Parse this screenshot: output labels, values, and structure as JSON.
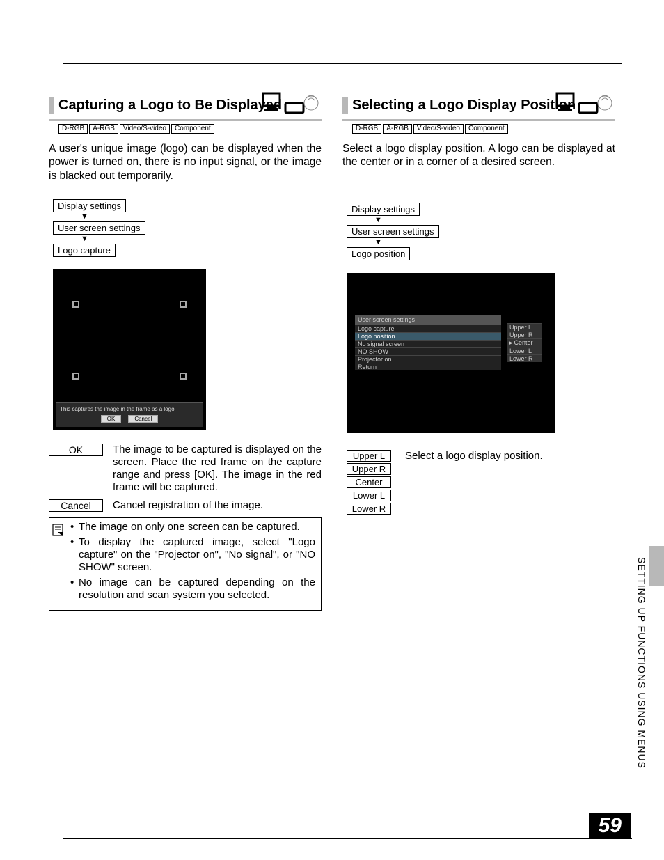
{
  "page_number": "59",
  "side_label": "SETTING UP FUNCTIONS USING MENUS",
  "input_tags": [
    "D-RGB",
    "A-RGB",
    "Video/S-video",
    "Component"
  ],
  "left": {
    "title": "Capturing a Logo to Be Displayed",
    "intro": "A user's unique image (logo) can be displayed when the power is turned on, there is no input signal, or the image is blacked out temporarily.",
    "menu_path": [
      "Display settings",
      "User screen settings",
      "Logo capture"
    ],
    "capture_panel_text": "This captures the image in the frame as a logo.",
    "capture_buttons": {
      "ok": "OK",
      "cancel": "Cancel"
    },
    "defs": {
      "ok_label": "OK",
      "ok_desc": "The image to be captured is displayed on the screen. Place the red frame on the capture range and press [OK]. The image in the red frame will be captured.",
      "cancel_label": "Cancel",
      "cancel_desc": "Cancel registration of the image."
    },
    "notes": [
      "The image on only one screen can be captured.",
      "To display the captured image, select \"Logo capture\" on the \"Projector on\", \"No signal\", or \"NO SHOW\" screen.",
      "No image can be captured depending on the resolution and scan system you selected."
    ]
  },
  "right": {
    "title": "Selecting a Logo Display Position",
    "intro": "Select a logo display position. A logo can be displayed at the center or in a corner of a desired screen.",
    "menu_path": [
      "Display settings",
      "User screen settings",
      "Logo position"
    ],
    "settings_panel": {
      "title": "User screen settings",
      "rows": [
        {
          "l": "Logo capture",
          "r": ""
        },
        {
          "l": "Logo position",
          "r": ""
        },
        {
          "l": "No signal screen",
          "r": ""
        },
        {
          "l": "NO SHOW",
          "r": ""
        },
        {
          "l": "Projector on",
          "r": ""
        },
        {
          "l": "Return",
          "r": ""
        }
      ],
      "popup": [
        "Upper L",
        "Upper R",
        "Center",
        "Lower L",
        "Lower R"
      ],
      "popup_selected": 2
    },
    "pos_options": [
      "Upper L",
      "Upper R",
      "Center",
      "Lower L",
      "Lower R"
    ],
    "pos_desc": "Select a logo display position."
  }
}
